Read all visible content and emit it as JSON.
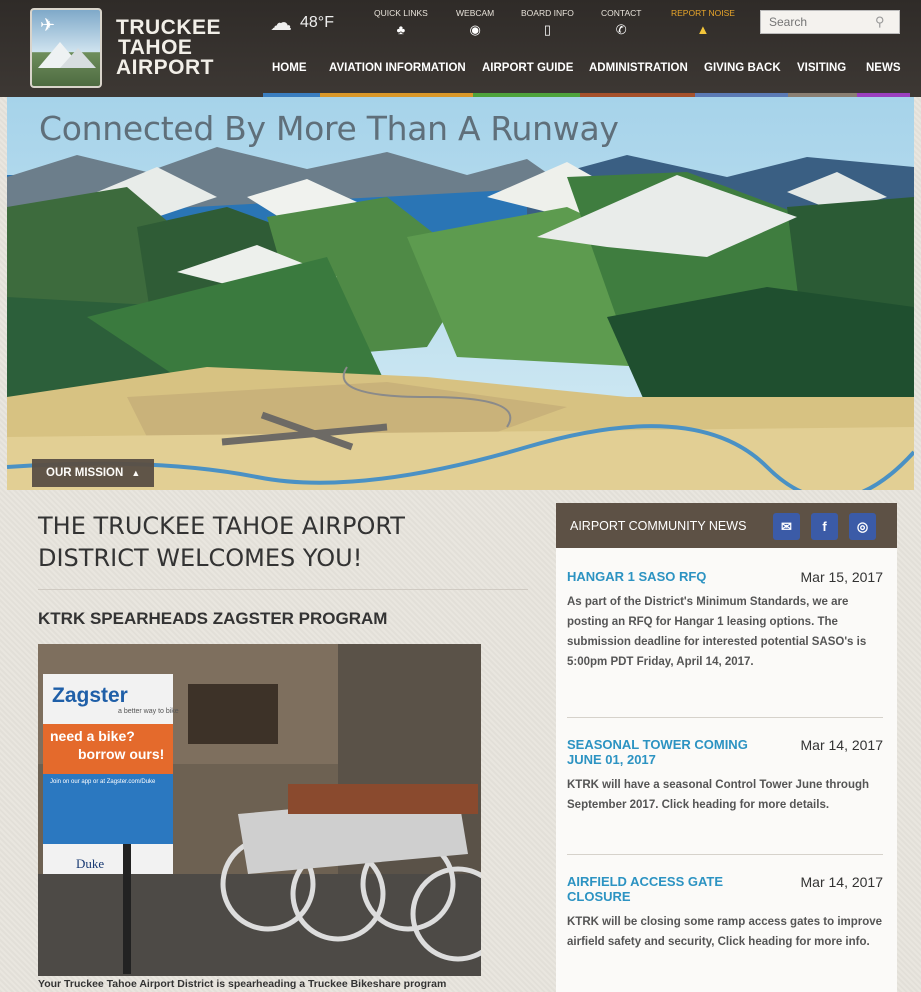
{
  "logo": {
    "line1": "TRUCKEE",
    "line2": "TAHOE",
    "line3": "AIRPORT"
  },
  "weather": {
    "icon": "cloud-icon",
    "temp": "48°F"
  },
  "utility": [
    {
      "label": "QUICK LINKS",
      "icon": "sitemap-icon",
      "glyph": "♣"
    },
    {
      "label": "WEBCAM",
      "icon": "webcam-icon",
      "glyph": "◉"
    },
    {
      "label": "BOARD INFO",
      "icon": "document-icon",
      "glyph": "▯"
    },
    {
      "label": "CONTACT",
      "icon": "phone-icon",
      "glyph": "✆"
    },
    {
      "label": "REPORT NOISE",
      "icon": "warning-icon",
      "glyph": "▲"
    }
  ],
  "search": {
    "placeholder": "Search"
  },
  "nav": [
    {
      "label": "HOME",
      "color": "#3a7ec0"
    },
    {
      "label": "AVIATION INFORMATION",
      "color": "#d9982a"
    },
    {
      "label": "AIRPORT GUIDE",
      "color": "#4ea33c"
    },
    {
      "label": "ADMINISTRATION",
      "color": "#a5512c"
    },
    {
      "label": "GIVING BACK",
      "color": "#5b7ab5"
    },
    {
      "label": "VISITING",
      "color": "#8a7f73"
    },
    {
      "label": "NEWS",
      "color": "#9b3fbf"
    }
  ],
  "hero": {
    "title": "Connected By More Than A Runway",
    "mission_label": "OUR MISSION"
  },
  "main": {
    "welcome_line1": "THE TRUCKEE TAHOE AIRPORT",
    "welcome_line2": "DISTRICT WELCOMES YOU!",
    "article_title": "KTRK SPEARHEADS ZAGSTER PROGRAM",
    "photo_sign": {
      "brand": "Zagster",
      "tagline": "a better way to bike",
      "headline1": "need a bike?",
      "headline2": "borrow ours!",
      "join": "Join on our app or at Zagster.com/Duke",
      "university": "Duke"
    },
    "caption": "Your Truckee Tahoe Airport District is spearheading a Truckee Bikeshare program"
  },
  "news": {
    "heading": "AIRPORT COMMUNITY NEWS",
    "social": [
      {
        "icon": "email-icon",
        "glyph": "✉"
      },
      {
        "icon": "facebook-icon",
        "glyph": "f"
      },
      {
        "icon": "instagram-icon",
        "glyph": "◎"
      }
    ],
    "items": [
      {
        "title": "HANGAR 1 SASO RFQ",
        "date": "Mar 15, 2017",
        "body": "As part of the District's Minimum Standards, we are posting an RFQ for Hangar 1 leasing options. The submission deadline for interested potential SASO's is 5:00pm PDT Friday, April 14, 2017."
      },
      {
        "title": "SEASONAL TOWER COMING JUNE 01, 2017",
        "date": "Mar 14, 2017",
        "body": "KTRK will have a seasonal Control Tower June through September 2017. Click heading for more details."
      },
      {
        "title": "AIRFIELD ACCESS GATE CLOSURE",
        "date": "Mar 14, 2017",
        "body": "KTRK will be closing some ramp access gates to improve airfield safety and security, Click heading for more info."
      }
    ]
  }
}
